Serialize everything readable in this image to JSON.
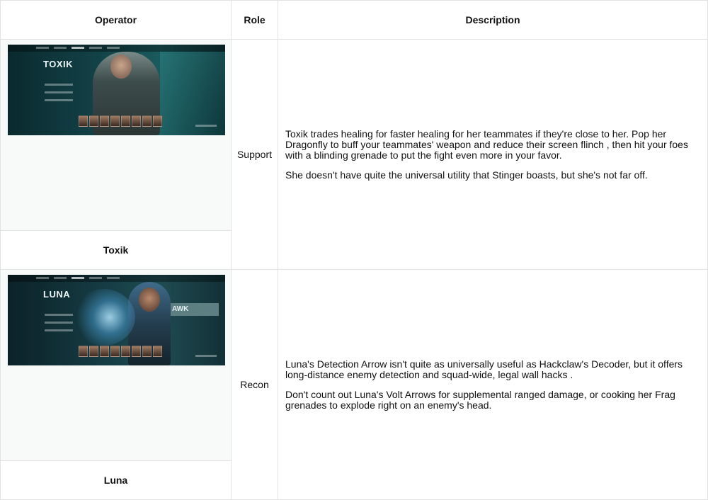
{
  "headers": {
    "operator": "Operator",
    "role": "Role",
    "description": "Description"
  },
  "rows": [
    {
      "name": "Toxik",
      "image_title": "TOXIK",
      "role": "Support",
      "paragraphs": [
        "Toxik trades healing for faster healing for her teammates if they're close to her. Pop her Dragonfly to buff your teammates' weapon and reduce their screen flinch , then hit your foes with a blinding grenade to put the fight even more in your favor.",
        "She doesn't have quite the universal utility that Stinger boasts, but she's not far off."
      ]
    },
    {
      "name": "Luna",
      "image_title": "LUNA",
      "image_sign": "AWK",
      "role": "Recon",
      "paragraphs": [
        "Luna's Detection Arrow isn't quite as universally useful as Hackclaw's Decoder, but it offers long-distance enemy detection and squad-wide, legal wall hacks .",
        "Don't count out Luna's Volt Arrows for supplemental ranged damage, or cooking her Frag grenades to explode right on an enemy's head."
      ]
    }
  ]
}
